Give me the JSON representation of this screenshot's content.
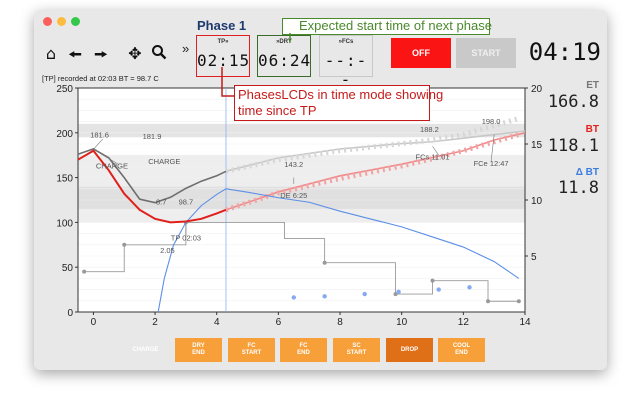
{
  "window": {
    "traffic_lights": [
      "#fc605c",
      "#fdbc40",
      "#34c84a"
    ]
  },
  "phase_title": "Phase 1",
  "toolbar": {
    "icons": [
      "home-icon",
      "back-arrow-icon",
      "forward-arrow-icon",
      "move-icon",
      "zoom-icon"
    ],
    "more_glyph": "»"
  },
  "lcds": {
    "tp": {
      "label": "TP»",
      "value": "02:15"
    },
    "dry": {
      "label": "»DRY",
      "value": "06:24"
    },
    "fcs": {
      "label": "»FCs",
      "value": "--:--"
    }
  },
  "buttons": {
    "off": "OFF",
    "start": "START"
  },
  "timer": "04:19",
  "status_line": "[TP] recorded at 02:03 BT = 98.7 C",
  "readouts": {
    "et": {
      "label": "ET",
      "value": "166.8"
    },
    "bt": {
      "label": "BT",
      "value": "118.1"
    },
    "dbt": {
      "label": "Δ BT",
      "value": "11.8"
    }
  },
  "callouts": {
    "top": "Expected start time of next phase",
    "side_line1": "PhasesLCDs in time mode showing",
    "side_line2": "time since TP"
  },
  "events": [
    {
      "label": "CHARGE",
      "active": false
    },
    {
      "label": "DRY END",
      "active": true
    },
    {
      "label": "FC START",
      "active": true
    },
    {
      "label": "FC END",
      "active": true
    },
    {
      "label": "SC START",
      "active": true
    },
    {
      "label": "DROP",
      "active": true,
      "pressed": true
    },
    {
      "label": "COOL END",
      "active": true
    }
  ],
  "chart_data": {
    "type": "line",
    "xlim": [
      -0.5,
      14
    ],
    "ylim_left": [
      0,
      250
    ],
    "ylim_right": [
      0,
      20
    ],
    "x_ticks": [
      "0",
      "2",
      "4",
      "6",
      "8",
      "10",
      "12",
      "14"
    ],
    "y_left_ticks": [
      "0",
      "50",
      "100",
      "150",
      "200",
      "250"
    ],
    "y_right_ticks": [
      "5",
      "10",
      "15",
      "20"
    ],
    "colors": {
      "et": "#888888",
      "bt": "#e0201b",
      "dbt": "#3c7de0",
      "steps": "#9a9a9a"
    },
    "annotations": [
      {
        "text": "181.6",
        "x": 0.2,
        "y": 195
      },
      {
        "text": "181.9",
        "x": 1.9,
        "y": 193
      },
      {
        "text": "CHARGE",
        "x": 2.3,
        "y": 165
      },
      {
        "text": "CHARGE",
        "x": 0.6,
        "y": 160
      },
      {
        "text": "98.7",
        "x": 3.0,
        "y": 120
      },
      {
        "text": "8.7",
        "x": 2.2,
        "y": 120
      },
      {
        "text": "TP 02:03",
        "x": 3.0,
        "y": 80
      },
      {
        "text": "2.05",
        "x": 2.4,
        "y": 66
      },
      {
        "text": "143.2",
        "x": 6.5,
        "y": 162
      },
      {
        "text": "DE 6:25",
        "x": 6.5,
        "y": 127
      },
      {
        "text": "188.2",
        "x": 10.9,
        "y": 201
      },
      {
        "text": "FCs 11:01",
        "x": 11.0,
        "y": 170
      },
      {
        "text": "198.0",
        "x": 12.9,
        "y": 210
      },
      {
        "text": "FCe 12:47",
        "x": 12.9,
        "y": 163
      }
    ],
    "series": [
      {
        "name": "ET",
        "x": [
          -0.5,
          0,
          0.5,
          1,
          1.5,
          2,
          2.5,
          3,
          3.5,
          4,
          4.3
        ],
        "y": [
          176,
          182,
          172,
          150,
          126,
          122,
          128,
          138,
          146,
          152,
          157
        ]
      },
      {
        "name": "BT",
        "x": [
          -0.5,
          0,
          0.5,
          1,
          1.5,
          2,
          2.5,
          3,
          3.5,
          4,
          4.3
        ],
        "y": [
          170,
          180,
          158,
          132,
          114,
          104,
          100,
          101,
          104,
          110,
          114
        ]
      },
      {
        "name": "ΔBT",
        "x": [
          2.1,
          2.3,
          2.6,
          3,
          3.5,
          4,
          4.3,
          5,
          6,
          7,
          8,
          9,
          10,
          11,
          12,
          13,
          13.8
        ],
        "y": [
          0,
          3,
          6,
          8,
          9.5,
          10.5,
          11,
          10.7,
          10.2,
          9.8,
          9.0,
          8.3,
          7.6,
          6.7,
          5.8,
          4.5,
          3.0
        ]
      },
      {
        "name": "ET projection",
        "x": [
          4.3,
          6,
          8,
          10,
          11,
          12,
          13,
          13.8
        ],
        "y": [
          157,
          170,
          180,
          188,
          192,
          198,
          208,
          216
        ]
      },
      {
        "name": "BT projection",
        "x": [
          4.3,
          6,
          8,
          10,
          11,
          12,
          13,
          13.8
        ],
        "y": [
          114,
          133,
          149,
          163,
          171,
          180,
          190,
          198
        ]
      },
      {
        "name": "ET extended",
        "x": [
          4.3,
          6,
          8,
          10,
          11,
          12,
          13,
          14
        ],
        "y": [
          157,
          172,
          182,
          188,
          190,
          194,
          198,
          202
        ]
      },
      {
        "name": "BT extended",
        "x": [
          4.3,
          6,
          8,
          10,
          12,
          13,
          14
        ],
        "y": [
          114,
          134,
          152,
          165,
          180,
          192,
          200
        ]
      }
    ]
  }
}
